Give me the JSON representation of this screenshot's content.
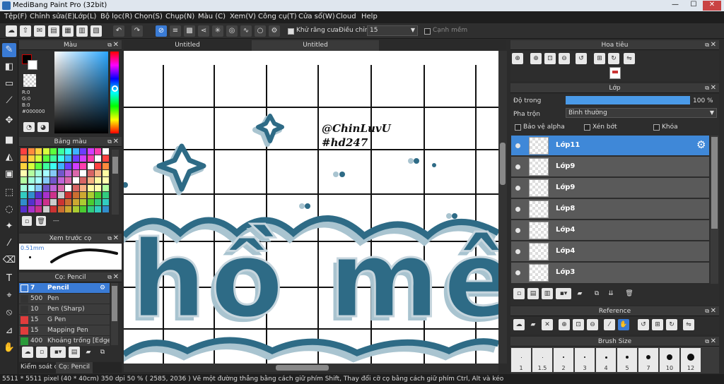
{
  "window": {
    "title": "MediBang Paint Pro (32bit)",
    "minimize": "—",
    "maximize": "☐",
    "close": "✕"
  },
  "menu": [
    "Tệp(F)",
    "Chỉnh sửa(E)",
    "Lớp(L)",
    "Bộ lọc(R)",
    "Chọn(S)",
    "Chụp(N)",
    "Màu (C)",
    "Xem(V)",
    "Công cụ(T)",
    "Cửa sổ(W)",
    "Cloud",
    "Help"
  ],
  "toolbar": {
    "antialias_label": "Khử răng cưa",
    "correction_label": "Điều chỉnh",
    "correction_value": "15",
    "edge_label": "Cạnh mềm"
  },
  "doc_tabs": [
    "Untitled",
    "Untitled"
  ],
  "color_panel": {
    "title": "Màu",
    "r": "R:0",
    "g": "G:0",
    "b": "B:0",
    "hex": "#000000",
    "fg": "#000000",
    "bg": "#ffffff"
  },
  "palette_panel": {
    "title": "Bảng màu",
    "dash": "---"
  },
  "brush_preview": {
    "title": "Xem trước cọ",
    "size": "0.51mm"
  },
  "brush_panel": {
    "title": "Cọ: Pencil",
    "items": [
      {
        "size": "7",
        "name": "Pencil",
        "color": "#3a7bd5"
      },
      {
        "size": "500",
        "name": "Pen",
        "color": "#333333"
      },
      {
        "size": "10",
        "name": "Pen (Sharp)",
        "color": "#333333"
      },
      {
        "size": "15",
        "name": "G Pen",
        "color": "#e03c3c"
      },
      {
        "size": "15",
        "name": "Mapping Pen",
        "color": "#e03c3c"
      },
      {
        "size": "400",
        "name": "Khoảng trống [Edge]",
        "color": "#2a9a3a"
      }
    ],
    "tab_control": "Kiểm soát cọ",
    "tab_brush": "Cọ: Pencil"
  },
  "navigator": {
    "title": "Hoa tiêu"
  },
  "layer_panel": {
    "title": "Lớp",
    "opacity_label": "Độ trong",
    "opacity_value": "100 %",
    "opacity": 1.0,
    "blend_label": "Pha trộn",
    "blend_value": "Bình thường",
    "protect_alpha": "Bảo vệ alpha",
    "clipping": "Xén bớt",
    "lock": "Khóa",
    "layers": [
      "Lớp11",
      "Lớp9",
      "Lớp9",
      "Lớp8",
      "Lớp4",
      "Lớp4",
      "Lớp3"
    ]
  },
  "reference_panel": {
    "title": "Reference"
  },
  "brush_size_panel": {
    "title": "Brush Size",
    "sizes": [
      "1",
      "1.5",
      "2",
      "3",
      "4",
      "5",
      "7",
      "10",
      "12"
    ]
  },
  "canvas": {
    "signature_line1": "@ChinLuvU",
    "signature_line2": "#hd247",
    "lettering": "hồ mêm"
  },
  "status": {
    "text": "5511 * 5511 pixel  (40 * 40cm)  350 dpi  50 %  ( 2585, 2036 )  Vẽ một đường thẳng bằng cách giữ phím Shift, Thay đổi cỡ cọ bằng cách giữ phím Ctrl, Alt và kéo"
  },
  "colors": {
    "accent": "#3a7bd5",
    "ink": "#2e6b86",
    "ink_shadow": "#a9c4d0"
  }
}
